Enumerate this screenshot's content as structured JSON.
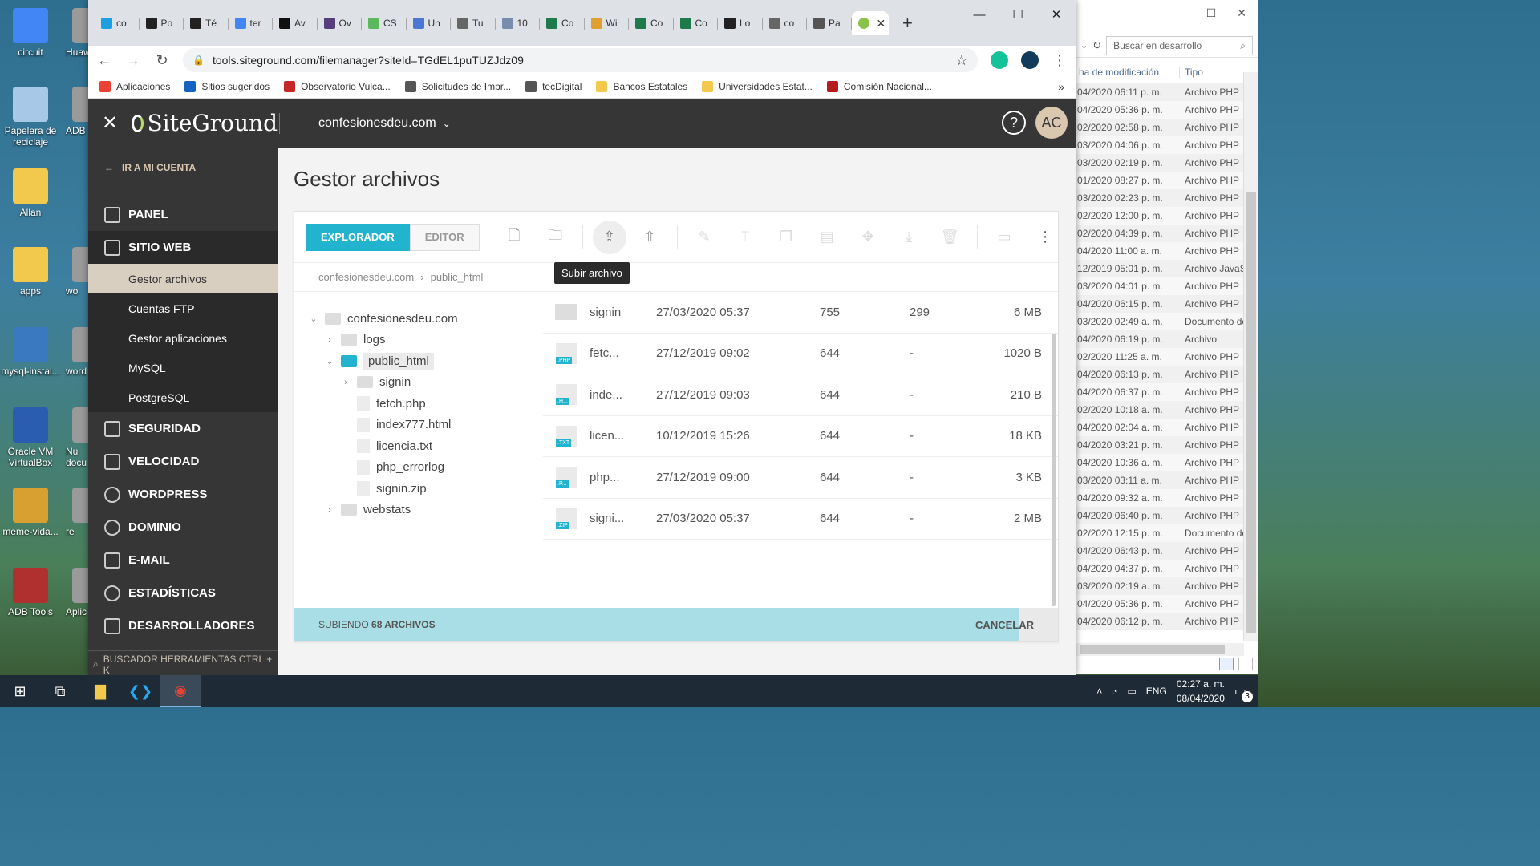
{
  "desktop": {
    "icons": [
      {
        "label": "circuit",
        "color": "#4285f4"
      },
      {
        "label": "Papelera de reciclaje",
        "color": "#a8c8e8"
      },
      {
        "label": "Allan",
        "color": "#f2c94c"
      },
      {
        "label": "apps",
        "color": "#f2c94c"
      },
      {
        "label": "mysql-instal...",
        "color": "#3a78c0"
      },
      {
        "label": "Oracle VM VirtualBox",
        "color": "#2a5db0"
      },
      {
        "label": "meme-vida...",
        "color": "#d8a030"
      },
      {
        "label": "ADB Tools",
        "color": "#b03030"
      }
    ],
    "icons_col2": [
      {
        "label": "Huaw"
      },
      {
        "label": "ADB"
      },
      {
        "label": "wo"
      },
      {
        "label": "word"
      },
      {
        "label": "Nu docu"
      },
      {
        "label": "re"
      },
      {
        "label": "Aplic"
      }
    ]
  },
  "explorer": {
    "search_placeholder": "Buscar en desarrollo",
    "col_date": "ha de modificación",
    "col_type": "Tipo",
    "rows": [
      {
        "d": "04/2020 06:11 p. m.",
        "t": "Archivo PHP"
      },
      {
        "d": "04/2020 05:36 p. m.",
        "t": "Archivo PHP"
      },
      {
        "d": "02/2020 02:58 p. m.",
        "t": "Archivo PHP"
      },
      {
        "d": "03/2020 04:06 p. m.",
        "t": "Archivo PHP"
      },
      {
        "d": "03/2020 02:19 p. m.",
        "t": "Archivo PHP"
      },
      {
        "d": "01/2020 08:27 p. m.",
        "t": "Archivo PHP"
      },
      {
        "d": "03/2020 02:23 p. m.",
        "t": "Archivo PHP"
      },
      {
        "d": "02/2020 12:00 p. m.",
        "t": "Archivo PHP"
      },
      {
        "d": "02/2020 04:39 p. m.",
        "t": "Archivo PHP"
      },
      {
        "d": "04/2020 11:00 a. m.",
        "t": "Archivo PHP"
      },
      {
        "d": "12/2019 05:01 p. m.",
        "t": "Archivo JavaSc"
      },
      {
        "d": "03/2020 04:01 p. m.",
        "t": "Archivo PHP"
      },
      {
        "d": "04/2020 06:15 p. m.",
        "t": "Archivo PHP"
      },
      {
        "d": "03/2020 02:49 a. m.",
        "t": "Documento de"
      },
      {
        "d": "04/2020 06:19 p. m.",
        "t": "Archivo"
      },
      {
        "d": "02/2020 11:25 a. m.",
        "t": "Archivo PHP"
      },
      {
        "d": "04/2020 06:13 p. m.",
        "t": "Archivo PHP"
      },
      {
        "d": "04/2020 06:37 p. m.",
        "t": "Archivo PHP"
      },
      {
        "d": "02/2020 10:18 a. m.",
        "t": "Archivo PHP"
      },
      {
        "d": "04/2020 02:04 a. m.",
        "t": "Archivo PHP"
      },
      {
        "d": "04/2020 03:21 p. m.",
        "t": "Archivo PHP"
      },
      {
        "d": "04/2020 10:36 a. m.",
        "t": "Archivo PHP"
      },
      {
        "d": "03/2020 03:11 a. m.",
        "t": "Archivo PHP"
      },
      {
        "d": "04/2020 09:32 a. m.",
        "t": "Archivo PHP"
      },
      {
        "d": "04/2020 06:40 p. m.",
        "t": "Archivo PHP"
      },
      {
        "d": "02/2020 12:15 p. m.",
        "t": "Documento de"
      },
      {
        "d": "04/2020 06:43 p. m.",
        "t": "Archivo PHP"
      },
      {
        "d": "04/2020 04:37 p. m.",
        "t": "Archivo PHP"
      },
      {
        "d": "03/2020 02:19 a. m.",
        "t": "Archivo PHP"
      },
      {
        "d": "04/2020 05:36 p. m.",
        "t": "Archivo PHP"
      },
      {
        "d": "04/2020 06:12 p. m.",
        "t": "Archivo PHP"
      }
    ]
  },
  "browser": {
    "tabs": [
      {
        "label": "co",
        "color": "#1ba1e2"
      },
      {
        "label": "Po",
        "color": "#222"
      },
      {
        "label": "Té",
        "color": "#222"
      },
      {
        "label": "ter",
        "color": "#4285f4"
      },
      {
        "label": "Av",
        "color": "#111"
      },
      {
        "label": "Ov",
        "color": "#563d7c"
      },
      {
        "label": "CS",
        "color": "#5cb85c"
      },
      {
        "label": "Un",
        "color": "#4a76d4"
      },
      {
        "label": "Tu",
        "color": "#666"
      },
      {
        "label": "10",
        "color": "#7a8bb0"
      },
      {
        "label": "Co",
        "color": "#1e7a4a"
      },
      {
        "label": "Wi",
        "color": "#e0a030"
      },
      {
        "label": "Co",
        "color": "#1e7a4a"
      },
      {
        "label": "Co",
        "color": "#1e7a4a"
      },
      {
        "label": "Lo",
        "color": "#222"
      },
      {
        "label": "co",
        "color": "#666"
      },
      {
        "label": "Pa",
        "color": "#555"
      }
    ],
    "url": "tools.siteground.com/filemanager?siteId=TGdEL1puTUZJdz09",
    "bookmarks": [
      {
        "label": "Aplicaciones",
        "color": "#e94235"
      },
      {
        "label": "Sitios sugeridos",
        "color": "#1565c0"
      },
      {
        "label": "Observatorio Vulca...",
        "color": "#c62828"
      },
      {
        "label": "Solicitudes de Impr...",
        "color": "#555"
      },
      {
        "label": "tecDigital",
        "color": "#555"
      },
      {
        "label": "Bancos Estatales",
        "color": "#f2c94c"
      },
      {
        "label": "Universidades Estat...",
        "color": "#f2c94c"
      },
      {
        "label": "Comisión Nacional...",
        "color": "#b71c1c"
      }
    ]
  },
  "sg": {
    "logo": "SiteGround",
    "domain": "confesionesdeu.com",
    "help": "?",
    "avatar": "AC",
    "back_label": "IR A MI CUENTA",
    "nav": {
      "panel": "PANEL",
      "sitio_web": "SITIO WEB",
      "sub": [
        "Gestor archivos",
        "Cuentas FTP",
        "Gestor aplicaciones",
        "MySQL",
        "PostgreSQL"
      ],
      "seguridad": "SEGURIDAD",
      "velocidad": "VELOCIDAD",
      "wordpress": "WORDPRESS",
      "dominio": "DOMINIO",
      "email": "E-MAIL",
      "estadisticas": "ESTADÍSTICAS",
      "desarrolladores": "DESARROLLADORES"
    },
    "search_label": "BUSCADOR HERRAMIENTAS CTRL + K",
    "page_title": "Gestor archivos",
    "tab_explorer": "EXPLORADOR",
    "tab_editor": "EDITOR",
    "tooltip": "Subir archivo",
    "breadcrumb": [
      "confesionesdeu.com",
      "public_html"
    ],
    "tree": {
      "root": "confesionesdeu.com",
      "logs": "logs",
      "public_html": "public_html",
      "signin": "signin",
      "files": [
        "fetch.php",
        "index777.html",
        "licencia.txt",
        "php_errorlog",
        "signin.zip"
      ],
      "webstats": "webstats"
    },
    "files": [
      {
        "name": "signin",
        "date": "27/03/2020 05:37",
        "perm": "755",
        "owner": "299",
        "size": "6 MB",
        "tag": ""
      },
      {
        "name": "fetc...",
        "date": "27/12/2019 09:02",
        "perm": "644",
        "owner": "-",
        "size": "1020 B",
        "tag": ".PHP"
      },
      {
        "name": "inde...",
        "date": "27/12/2019 09:03",
        "perm": "644",
        "owner": "-",
        "size": "210 B",
        "tag": ".H..."
      },
      {
        "name": "licen...",
        "date": "10/12/2019 15:26",
        "perm": "644",
        "owner": "-",
        "size": "18 KB",
        "tag": ".TXT"
      },
      {
        "name": "php...",
        "date": "27/12/2019 09:00",
        "perm": "644",
        "owner": "-",
        "size": "3 KB",
        "tag": ".P..."
      },
      {
        "name": "signi...",
        "date": "27/03/2020 05:37",
        "perm": "644",
        "owner": "-",
        "size": "2 MB",
        "tag": ".ZIP"
      }
    ],
    "upload": {
      "prefix": "SUBIENDO",
      "count": "68 ARCHIVOS",
      "cancel": "CANCELAR",
      "progress": 0.95
    }
  },
  "taskbar": {
    "lang": "ENG",
    "time": "02:27 a. m.",
    "date": "08/04/2020",
    "notifications": "3"
  }
}
